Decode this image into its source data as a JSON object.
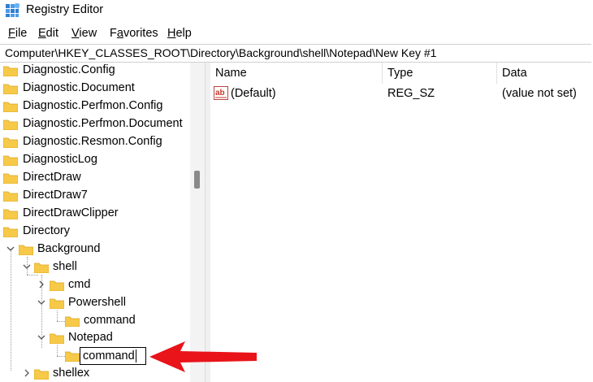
{
  "window": {
    "title": "Registry Editor",
    "icon": "registry-editor-icon"
  },
  "menu": [
    "File",
    "Edit",
    "View",
    "Favorites",
    "Help"
  ],
  "address": "Computer\\HKEY_CLASSES_ROOT\\Directory\\Background\\shell\\Notepad\\New Key #1",
  "tree": {
    "top_items": [
      "Diagnostic.Config",
      "Diagnostic.Document",
      "Diagnostic.Perfmon.Config",
      "Diagnostic.Perfmon.Document",
      "Diagnostic.Resmon.Config",
      "DiagnosticLog",
      "DirectDraw",
      "DirectDraw7",
      "DirectDrawClipper",
      "Directory"
    ],
    "background": "Background",
    "shell": "shell",
    "cmd": "cmd",
    "powershell": "Powershell",
    "powershell_command": "command",
    "notepad": "Notepad",
    "editing_value": "command",
    "shellex": "shellex"
  },
  "values_table": {
    "columns": [
      "Name",
      "Type",
      "Data"
    ],
    "rows": [
      {
        "name": "(Default)",
        "type": "REG_SZ",
        "data": "(value not set)"
      }
    ]
  },
  "colors": {
    "folder": "#f7c948",
    "folder_edge": "#d9a520",
    "arrow": "#e8141a"
  }
}
